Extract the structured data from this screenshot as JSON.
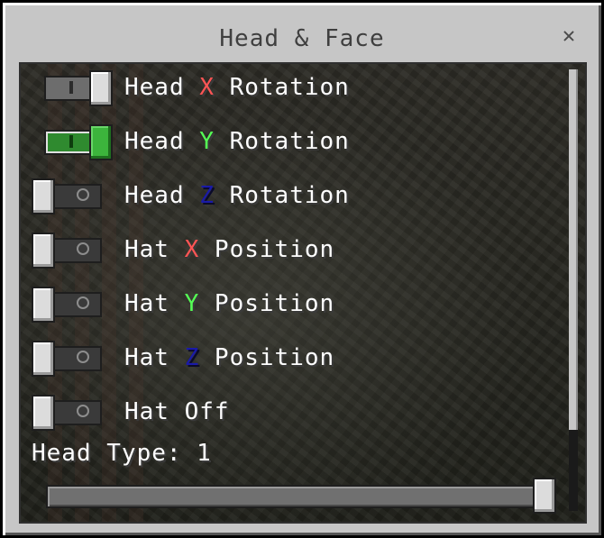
{
  "dialog": {
    "title": "Head & Face",
    "close_symbol": "✕"
  },
  "toggles": [
    {
      "prefix": "Head ",
      "axis": "X",
      "suffix": " Rotation",
      "axis_color": "red",
      "state": "on",
      "style": "gray"
    },
    {
      "prefix": "Head ",
      "axis": "Y",
      "suffix": " Rotation",
      "axis_color": "green",
      "state": "on",
      "style": "green"
    },
    {
      "prefix": "Head ",
      "axis": "Z",
      "suffix": " Rotation",
      "axis_color": "blue",
      "state": "off",
      "style": "gray"
    },
    {
      "prefix": "Hat ",
      "axis": "X",
      "suffix": " Position",
      "axis_color": "red",
      "state": "off",
      "style": "gray"
    },
    {
      "prefix": "Hat ",
      "axis": "Y",
      "suffix": " Position",
      "axis_color": "green",
      "state": "off",
      "style": "gray"
    },
    {
      "prefix": "Hat ",
      "axis": "Z",
      "suffix": " Position",
      "axis_color": "blue",
      "state": "off",
      "style": "gray"
    },
    {
      "prefix": "Hat Off",
      "axis": "",
      "suffix": "",
      "axis_color": "",
      "state": "off",
      "style": "gray"
    }
  ],
  "head_type": {
    "label": "Head Type: 1",
    "value_fraction": 1.0
  },
  "colors": {
    "red": "#ff5555",
    "green": "#55ff55",
    "blue": "#1a1aa8",
    "panel": "#c6c6c6",
    "toggle_on_green": "#3cb43c"
  }
}
